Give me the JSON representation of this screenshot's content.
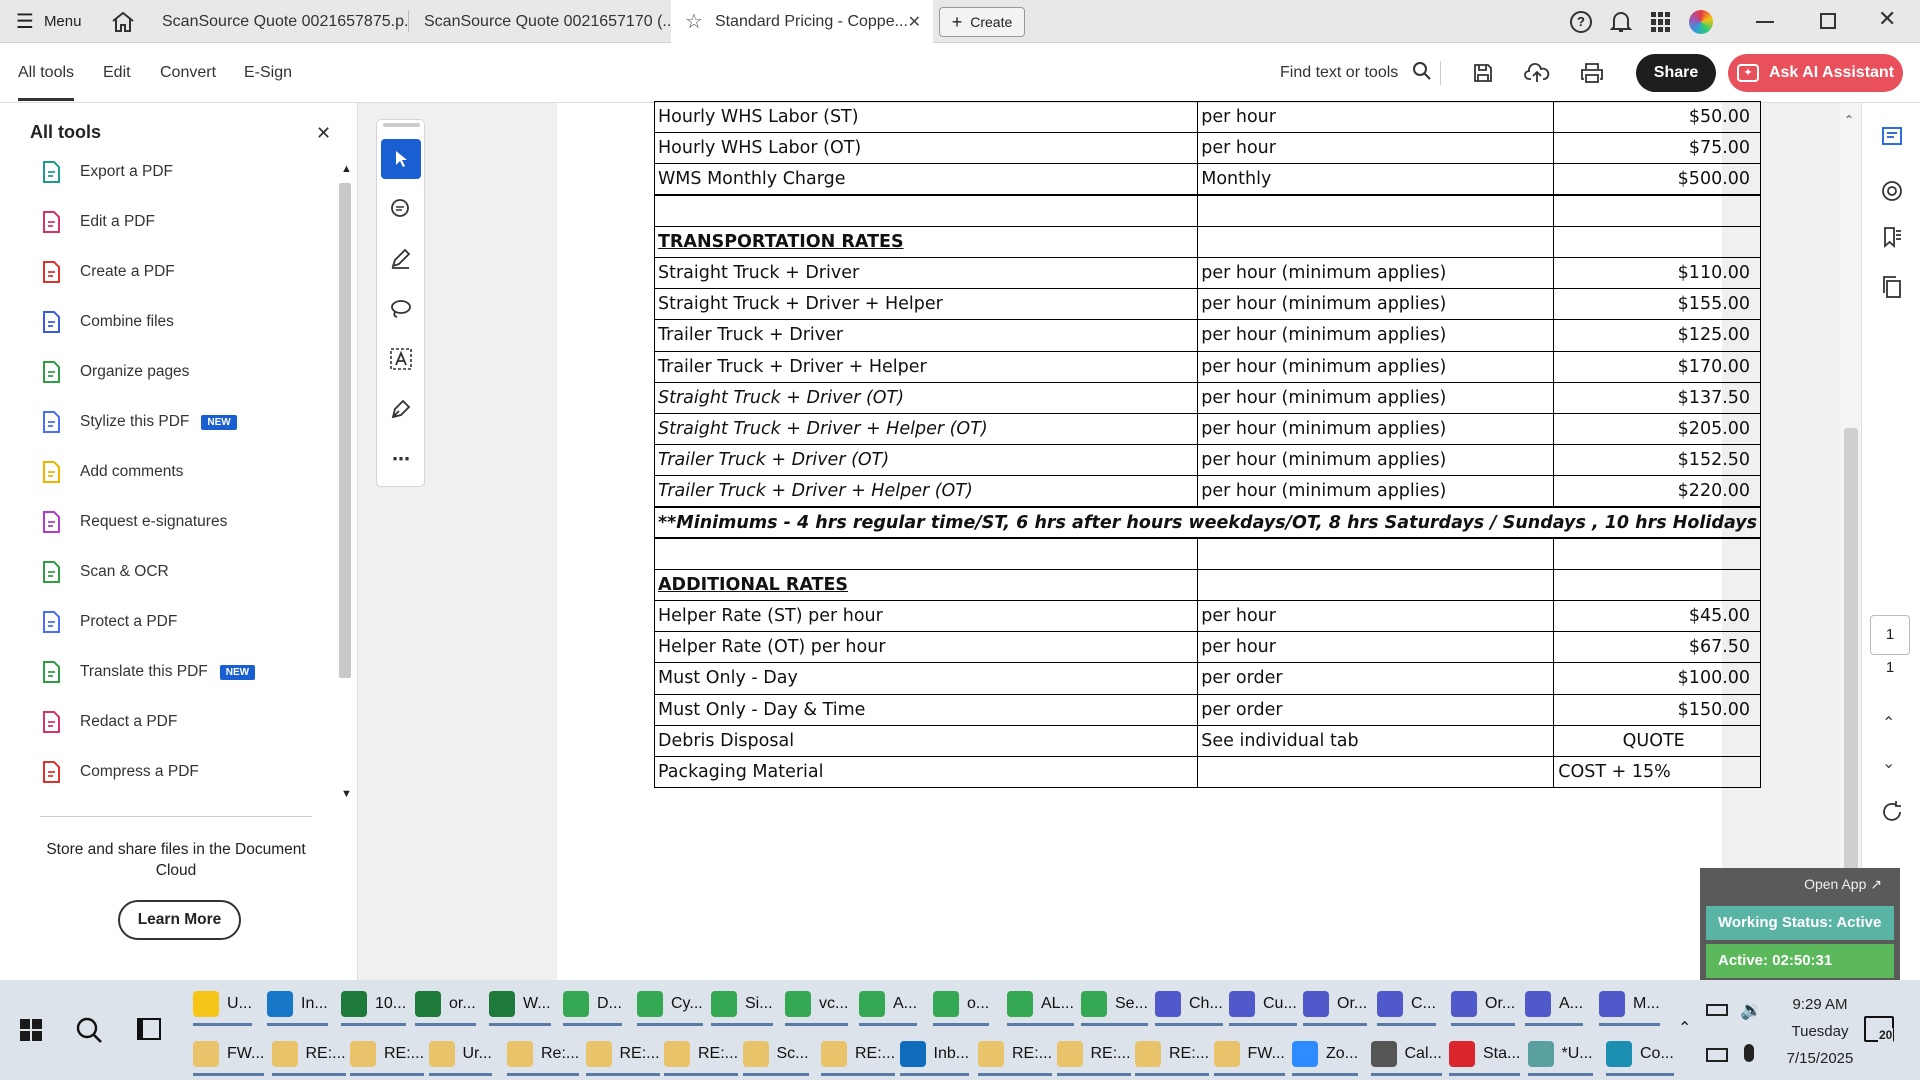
{
  "tabs": {
    "menu_label": "Menu",
    "items": [
      {
        "label": "ScanSource Quote 0021657875.p..."
      },
      {
        "label": "ScanSource Quote 0021657170 (..."
      },
      {
        "label": "Standard Pricing - Coppe..."
      }
    ],
    "create_label": "Create"
  },
  "toolbar": {
    "menus": [
      "All tools",
      "Edit",
      "Convert",
      "E-Sign"
    ],
    "find_label": "Find text or tools",
    "share_label": "Share",
    "ai_label": "Ask AI Assistant"
  },
  "leftpanel": {
    "title": "All tools",
    "tools": [
      {
        "label": "Export a PDF",
        "color": "#1e9c8a"
      },
      {
        "label": "Edit a PDF",
        "color": "#d6336c"
      },
      {
        "label": "Create a PDF",
        "color": "#e03131"
      },
      {
        "label": "Combine files",
        "color": "#3b5bdb"
      },
      {
        "label": "Organize pages",
        "color": "#2f9e44"
      },
      {
        "label": "Stylize this PDF",
        "color": "#4c6ef5",
        "badge": "NEW"
      },
      {
        "label": "Add comments",
        "color": "#f0b400"
      },
      {
        "label": "Request e-signatures",
        "color": "#ae3ec9"
      },
      {
        "label": "Scan & OCR",
        "color": "#2f9e44"
      },
      {
        "label": "Protect a PDF",
        "color": "#4c6ef5"
      },
      {
        "label": "Translate this PDF",
        "color": "#2f9e44",
        "badge": "NEW"
      },
      {
        "label": "Redact a PDF",
        "color": "#d6336c"
      },
      {
        "label": "Compress a PDF",
        "color": "#e03131"
      }
    ],
    "cloud_text": "Store and share files in the Document Cloud",
    "learn_more": "Learn More"
  },
  "table": {
    "rows": [
      {
        "c1": "Hourly WHS Labor (ST)",
        "c2": "per hour",
        "c3": "$50.00"
      },
      {
        "c1": "Hourly WHS Labor (OT)",
        "c2": "per hour",
        "c3": "$75.00"
      },
      {
        "c1": "WMS Monthly Charge",
        "c2": "Monthly",
        "c3": "$500.00"
      },
      {
        "c1": "",
        "c2": "",
        "c3": ""
      },
      {
        "c1": "TRANSPORTATION RATES",
        "c2": "",
        "c3": ""
      },
      {
        "c1": "Straight Truck + Driver",
        "c2": "per hour (minimum applies)",
        "c3": "$110.00"
      },
      {
        "c1": "Straight Truck + Driver + Helper",
        "c2": "per hour (minimum applies)",
        "c3": "$155.00"
      },
      {
        "c1": "Trailer Truck + Driver",
        "c2": "per hour (minimum applies)",
        "c3": "$125.00"
      },
      {
        "c1": "Trailer Truck + Driver + Helper",
        "c2": "per hour (minimum applies)",
        "c3": "$170.00"
      },
      {
        "c1": "Straight Truck + Driver (OT)",
        "c2": "per hour (minimum applies)",
        "c3": "$137.50"
      },
      {
        "c1": "Straight Truck + Driver + Helper (OT)",
        "c2": "per hour (minimum applies)",
        "c3": "$205.00"
      },
      {
        "c1": "Trailer Truck + Driver (OT)",
        "c2": "per hour (minimum applies)",
        "c3": "$152.50"
      },
      {
        "c1": "Trailer Truck + Driver + Helper (OT)",
        "c2": "per hour (minimum applies)",
        "c3": "$220.00"
      },
      {
        "note": "**Minimums -  4 hrs regular time/ST, 6 hrs after hours weekdays/OT, 8 hrs Saturdays / Sundays , 10 hrs Holidays"
      },
      {
        "c1": "",
        "c2": "",
        "c3": ""
      },
      {
        "c1": "ADDITIONAL RATES",
        "c2": "",
        "c3": ""
      },
      {
        "c1": "Helper Rate (ST) per hour",
        "c2": "per hour",
        "c3": "$45.00"
      },
      {
        "c1": "Helper Rate (OT) per hour",
        "c2": "per hour",
        "c3": "$67.50"
      },
      {
        "c1": "Must Only - Day",
        "c2": "per order",
        "c3": "$100.00"
      },
      {
        "c1": "Must Only - Day & Time",
        "c2": "per order",
        "c3": "$150.00"
      },
      {
        "c1": "Debris Disposal",
        "c2": "See individual tab",
        "c3": "QUOTE"
      },
      {
        "c1": "Packaging Material",
        "c2": "",
        "c3": "COST + 15%"
      }
    ]
  },
  "rightrail": {
    "page_current": "1",
    "page_total": "1"
  },
  "widget": {
    "open_app": "Open App",
    "status": "Working Status: Active",
    "active": "Active: 02:50:31"
  },
  "taskbar": {
    "row1": [
      {
        "label": "U...",
        "color": "#f5c518"
      },
      {
        "label": "In...",
        "color": "#1877c9"
      },
      {
        "label": "10...",
        "color": "#1d7a3a"
      },
      {
        "label": "or...",
        "color": "#1d7a3a"
      },
      {
        "label": "W...",
        "color": "#1d7a3a"
      },
      {
        "label": "D...",
        "color": "#34a853"
      },
      {
        "label": "Cy...",
        "color": "#34a853"
      },
      {
        "label": "Si...",
        "color": "#34a853"
      },
      {
        "label": "vc...",
        "color": "#34a853"
      },
      {
        "label": "A...",
        "color": "#34a853"
      },
      {
        "label": "o...",
        "color": "#34a853"
      },
      {
        "label": "AL...",
        "color": "#34a853"
      },
      {
        "label": "Se...",
        "color": "#34a853"
      },
      {
        "label": "Ch...",
        "color": "#5059c9"
      },
      {
        "label": "Cu...",
        "color": "#5059c9"
      },
      {
        "label": "Or...",
        "color": "#5059c9"
      },
      {
        "label": "C...",
        "color": "#5059c9"
      },
      {
        "label": "Or...",
        "color": "#5059c9"
      },
      {
        "label": "A...",
        "color": "#5059c9"
      },
      {
        "label": "M...",
        "color": "#5059c9"
      }
    ],
    "row2": [
      {
        "label": "FW...",
        "color": "#e8c36a"
      },
      {
        "label": "RE:...",
        "color": "#e8c36a"
      },
      {
        "label": "RE:...",
        "color": "#e8c36a"
      },
      {
        "label": "Ur...",
        "color": "#e8c36a"
      },
      {
        "label": "Re:...",
        "color": "#e8c36a"
      },
      {
        "label": "RE:...",
        "color": "#e8c36a"
      },
      {
        "label": "RE:...",
        "color": "#e8c36a"
      },
      {
        "label": "Sc...",
        "color": "#e8c36a"
      },
      {
        "label": "RE:...",
        "color": "#e8c36a"
      },
      {
        "label": "Inb...",
        "color": "#0f6cbd"
      },
      {
        "label": "RE:...",
        "color": "#e8c36a"
      },
      {
        "label": "RE:...",
        "color": "#e8c36a"
      },
      {
        "label": "RE:...",
        "color": "#e8c36a"
      },
      {
        "label": "FW...",
        "color": "#e8c36a"
      },
      {
        "label": "Zo...",
        "color": "#2d8cff"
      },
      {
        "label": "Cal...",
        "color": "#555"
      },
      {
        "label": "Sta...",
        "color": "#d9252b"
      },
      {
        "label": "*U...",
        "color": "#5aa0a0"
      },
      {
        "label": "Co...",
        "color": "#1c8fb3"
      }
    ],
    "time": "9:29 AM",
    "day": "Tuesday",
    "date": "7/15/2025",
    "notif_count": "20"
  }
}
